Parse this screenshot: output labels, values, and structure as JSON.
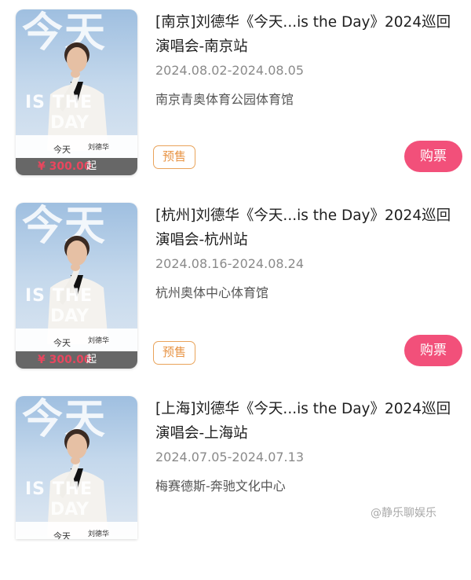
{
  "events": [
    {
      "title": "[南京]刘德华《今天...is the Day》2024巡回演唱会-南京站",
      "date": "2024.08.02-2024.08.05",
      "venue": "南京青奥体育公园体育馆",
      "presale_label": "预售",
      "buy_label": "购票",
      "poster": {
        "big_title": "今天",
        "is_the": "IS THE",
        "day": "DAY",
        "mini_title": "今天",
        "mini_name": "刘德华",
        "price": "¥ 300.00",
        "price_suffix": "起"
      }
    },
    {
      "title": "[杭州]刘德华《今天...is the Day》2024巡回演唱会-杭州站",
      "date": "2024.08.16-2024.08.24",
      "venue": "杭州奥体中心体育馆",
      "presale_label": "预售",
      "buy_label": "购票",
      "poster": {
        "big_title": "今天",
        "is_the": "IS THE",
        "day": "DAY",
        "mini_title": "今天",
        "mini_name": "刘德华",
        "price": "¥ 300.00",
        "price_suffix": "起"
      }
    },
    {
      "title": "[上海]刘德华《今天...is the Day》2024巡回演唱会-上海站",
      "date": "2024.07.05-2024.07.13",
      "venue": "梅赛德斯-奔驰文化中心",
      "poster": {
        "big_title": "今天",
        "is_the": "IS THE",
        "day": "DAY",
        "mini_title": "今天",
        "mini_name": "刘德华"
      }
    }
  ],
  "watermark": "@静乐聊娱乐",
  "colors": {
    "buy_button": "#f2507a",
    "presale_border": "#e9a35a",
    "price": "#e9465e"
  }
}
